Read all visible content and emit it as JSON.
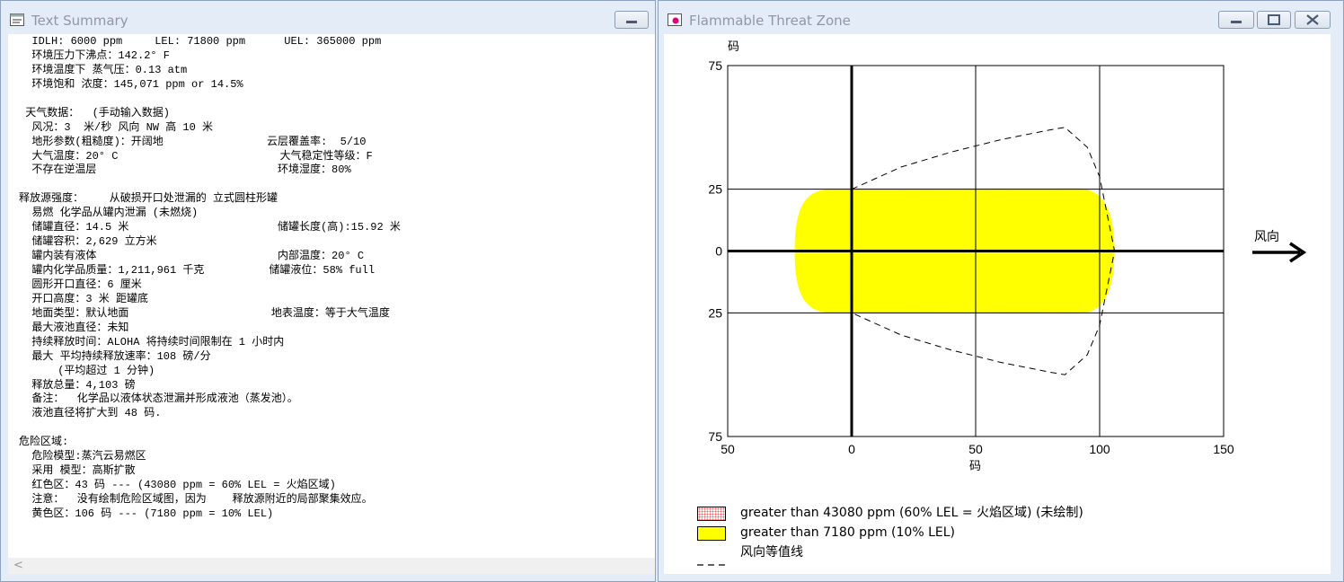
{
  "text_window": {
    "title": "Text Summary",
    "lines": [
      "  IDLH: 6000 ppm     LEL: 71800 ppm      UEL: 365000 ppm",
      "  环境压力下沸点：142.2° F",
      "  环境温度下 蒸气压：0.13 atm",
      "  环境饱和 浓度：145,071 ppm or 14.5%",
      "",
      " 天气数据：  (手动输入数据)",
      "  风况：3  米/秒 风向 NW 高 10 米",
      "  地形参数(粗糙度)：开阔地                云层覆盖率:  5/10",
      "  大气温度：20° C                         大气稳定性等级：F",
      "  不存在逆温层                            环境湿度：80%",
      "",
      "释放源强度：    从破损开口处泄漏的 立式圆柱形罐",
      "  易燃 化学品从罐内泄漏 (未燃烧)",
      "  储罐直径：14.5 米                       储罐长度(高):15.92 米",
      "  储罐容积：2,629 立方米",
      "  罐内装有液体                            内部温度：20° C",
      "  罐内化学品质量：1,211,961 千克          储罐液位：58% full",
      "  圆形开口直径：6 厘米",
      "  开口高度：3 米 距罐底",
      "  地面类型：默认地面                      地表温度：等于大气温度",
      "  最大液池直径：未知",
      "  持续释放时间：ALOHA 将持续时间限制在 1 小时内",
      "  最大 平均持续释放速率：108 磅/分",
      "      (平均超过 1 分钟)",
      "  释放总量：4,103 磅",
      "  备注：  化学品以液体状态泄漏并形成液池（蒸发池）。",
      "  液池直径将扩大到 48 码.",
      "",
      "危险区域:",
      "  危险模型:蒸汽云易燃区",
      "  采用 模型：高斯扩散",
      "  红色区：43 码 --- (43080 ppm = 60% LEL = 火焰区域)",
      "  注意：  没有绘制危险区域图，因为    释放源附近的局部聚集效应。",
      "  黄色区：106 码 --- (7180 ppm = 10% LEL)"
    ],
    "scroll_arrow": "<"
  },
  "plot_window": {
    "title": "Flammable Threat Zone",
    "y_unit": "码",
    "x_unit": "码",
    "y_tick_labels": [
      "75",
      "25",
      "0",
      "25",
      "75"
    ],
    "x_tick_labels": [
      "50",
      "0",
      "50",
      "100",
      "150"
    ],
    "wind_label": "风向",
    "legend": [
      {
        "label": "greater than 43080 ppm (60% LEL = 火焰区域) (未绘制)",
        "swatch": "red-dotted"
      },
      {
        "label": "greater than 7180 ppm (10% LEL)",
        "swatch": "yellow"
      },
      {
        "label": "风向等值线",
        "swatch": "dashed-line"
      }
    ],
    "colors": {
      "yellow_zone": "#ffff00",
      "red_zone": "#ff0000",
      "axis": "#000000"
    }
  },
  "chart_data": {
    "type": "area",
    "x_range": [
      -50,
      150
    ],
    "y_range": [
      -75,
      75
    ],
    "grid": true,
    "series": [
      {
        "name": "greater than 7180 ppm (10% LEL)",
        "extent_x": [
          -23,
          106
        ],
        "half_width": 25,
        "color": "#ffff00"
      }
    ],
    "confidence_contour": {
      "x": [
        0,
        20,
        40,
        60,
        80,
        86,
        95,
        100,
        106
      ],
      "y_upper": [
        25,
        34,
        40,
        45,
        49,
        50,
        42,
        30,
        0
      ]
    }
  }
}
